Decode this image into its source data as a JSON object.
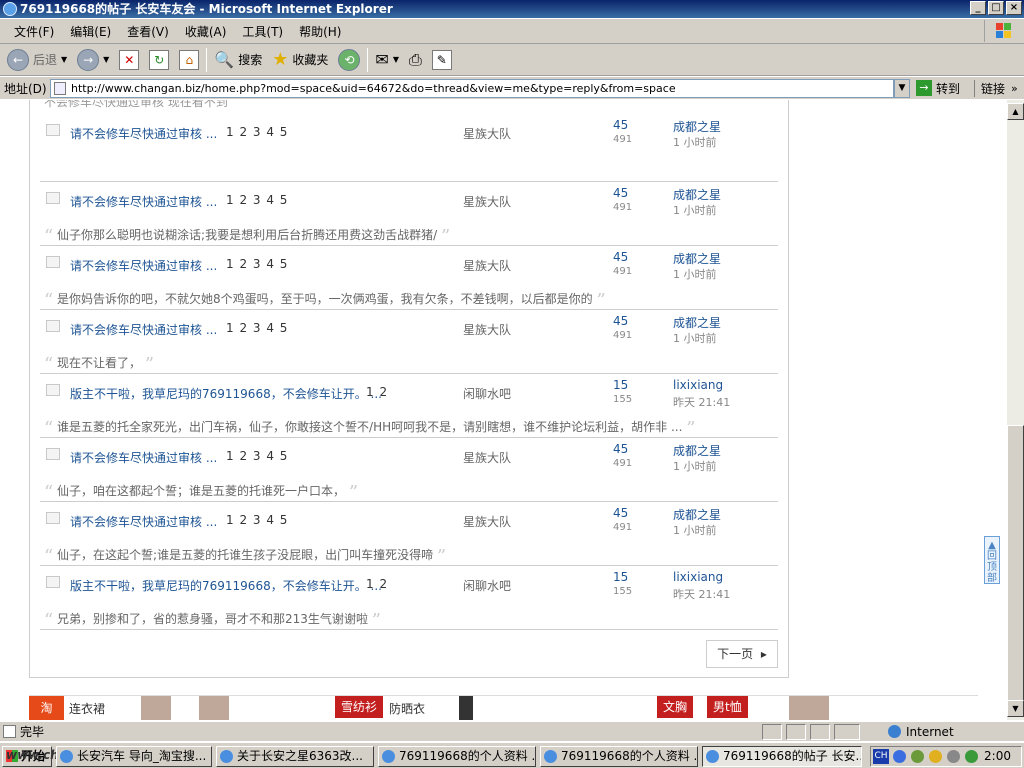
{
  "window": {
    "title": "769119668的帖子 长安车友会 - Microsoft Internet Explorer"
  },
  "menu": [
    "文件(F)",
    "编辑(E)",
    "查看(V)",
    "收藏(A)",
    "工具(T)",
    "帮助(H)"
  ],
  "toolbar": {
    "back": "后退",
    "search": "搜索",
    "favorites": "收藏夹"
  },
  "address": {
    "label": "地址(D)",
    "url": "http://www.changan.biz/home.php?mod=space&uid=64672&do=thread&view=me&type=reply&from=space",
    "go": "转到",
    "links": "链接"
  },
  "top_partial": "不会修车尽快通过审核 现在看不到",
  "threads": [
    {
      "title": "请不会修车尽快通过审核 ...",
      "pages": "1 2 3 4 5",
      "forum": "星族大队",
      "replies": "45",
      "views": "491",
      "last_user": "成都之星",
      "last_time": "1 小时前",
      "quote": ""
    },
    {
      "title": "请不会修车尽快通过审核 ...",
      "pages": "1 2 3 4 5",
      "forum": "星族大队",
      "replies": "45",
      "views": "491",
      "last_user": "成都之星",
      "last_time": "1 小时前",
      "quote": "仙子你那么聪明也说糊涂话;我要是想利用后台折腾还用费这劲舌战群猪/"
    },
    {
      "title": "请不会修车尽快通过审核 ...",
      "pages": "1 2 3 4 5",
      "forum": "星族大队",
      "replies": "45",
      "views": "491",
      "last_user": "成都之星",
      "last_time": "1 小时前",
      "quote": "是你妈告诉你的吧，不就欠她8个鸡蛋吗，至于吗，一次俩鸡蛋，我有欠条，不差钱啊，以后都是你的"
    },
    {
      "title": "请不会修车尽快通过审核 ...",
      "pages": "1 2 3 4 5",
      "forum": "星族大队",
      "replies": "45",
      "views": "491",
      "last_user": "成都之星",
      "last_time": "1 小时前",
      "quote": "现在不让看了，"
    },
    {
      "title": "版主不干啦，我草尼玛的769119668，不会修车让开。 ...",
      "pages": "1 2",
      "forum": "闲聊水吧",
      "replies": "15",
      "views": "155",
      "last_user": "lixixiang",
      "last_time": "昨天 21:41",
      "quote": "谁是五菱的托全家死光，出门车祸，仙子，你敢接这个誓不/HH呵呵我不是，请别瞎想，谁不维护论坛利益，胡作非 ..."
    },
    {
      "title": "请不会修车尽快通过审核 ...",
      "pages": "1 2 3 4 5",
      "forum": "星族大队",
      "replies": "45",
      "views": "491",
      "last_user": "成都之星",
      "last_time": "1 小时前",
      "quote": "仙子，咱在这都起个誓；谁是五菱的托谁死一户口本，"
    },
    {
      "title": "请不会修车尽快通过审核 ...",
      "pages": "1 2 3 4 5",
      "forum": "星族大队",
      "replies": "45",
      "views": "491",
      "last_user": "成都之星",
      "last_time": "1 小时前",
      "quote": "仙子，在这起个誓;谁是五菱的托谁生孩子没屁眼，出门叫车撞死没得啼"
    },
    {
      "title": "版主不干啦，我草尼玛的769119668，不会修车让开。 ...",
      "pages": "1 2",
      "forum": "闲聊水吧",
      "replies": "15",
      "views": "155",
      "last_user": "lixixiang",
      "last_time": "昨天 21:41",
      "quote": "兄弟，别掺和了，省的惹身骚，哥才不和那213生气谢谢啦"
    }
  ],
  "next_page": "下一页",
  "back_top": "回顶部",
  "ads": {
    "a1": "连衣裙",
    "a2": "雪纺衫",
    "a3": "防晒衣",
    "a4": "文胸",
    "a5": "男t恤"
  },
  "status": {
    "text": "完毕",
    "zone": "Internet"
  },
  "taskbar": {
    "start": "开始",
    "watermark": "www.changan.biz",
    "tasks": [
      "长安汽车 导向_淘宝搜...",
      "关于长安之星6363改...",
      "769119668的个人资料 ...",
      "769119668的个人资料 ...",
      "769119668的帖子 长安..."
    ],
    "tray_lang": "CH",
    "clock": "2:00"
  }
}
